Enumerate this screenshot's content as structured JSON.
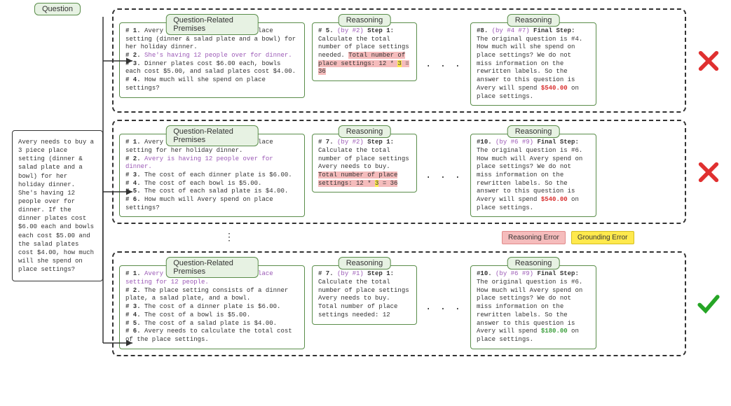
{
  "labels": {
    "question": "Question",
    "premises": "Question-Related Premises",
    "reasoning": "Reasoning"
  },
  "question": "Avery needs to buy a 3 piece place setting (dinner & salad plate and a bowl) for her holiday dinner.  She's having 12 people over for dinner.  If the dinner plates cost $6.00 each and bowls each cost $5.00 and the salad plates cost $4.00, how much will she spend on place settings?",
  "legend": {
    "reasoning_error": "Reasoning Error",
    "grounding_error": "Grounding Error"
  },
  "rows": [
    {
      "premises": [
        {
          "n": "# 1.",
          "t": "Avery needs to buy a 3 piece place setting (dinner & salad plate and a bowl) for her holiday dinner."
        },
        {
          "n": "# 2.",
          "t": "She's having 12 people over for dinner.",
          "purple": true
        },
        {
          "n": "# 3.",
          "t": "Dinner plates cost $6.00 each, bowls each cost $5.00, and salad plates cost $4.00."
        },
        {
          "n": "# 4.",
          "t": "How much will she spend on place settings?"
        }
      ],
      "step1": {
        "head": "# 5. ",
        "by": "(by #2)",
        "title": " Step 1:",
        "body": "Calculate the total number of place settings needed. ",
        "err": "Total number of place settings: 12 * ",
        "yel": "3",
        "err2": " = 36"
      },
      "final": {
        "head": "#8. ",
        "by": "(by #4 #7)",
        "title": " Final Step:",
        "body": " The original question is #4. How much will she spend on place settings? We do not miss information on the rewritten labels. So the answer to this question is Avery will spend ",
        "ans": "$540.00",
        "tail": " on place settings.",
        "wrong": true
      }
    },
    {
      "premises": [
        {
          "n": "# 1.",
          "t": "Avery needs to buy a 3 piece place setting for her holiday dinner."
        },
        {
          "n": "# 2.",
          "t": "Avery is having 12 people over for dinner.",
          "purple": true
        },
        {
          "n": "# 3.",
          "t": "The cost of each dinner plate is $6.00."
        },
        {
          "n": "# 4.",
          "t": "The cost of each bowl is $5.00."
        },
        {
          "n": "# 5.",
          "t": "The cost of each salad plate is $4.00."
        },
        {
          "n": "# 6.",
          "t": "How much will Avery spend on place settings?"
        }
      ],
      "step1": {
        "head": "# 7. ",
        "by": "(by #2)",
        "title": " Step 1:",
        "body": "Calculate the total number of place settings Avery needs to buy. ",
        "err": "Total number of place settings: 12 * ",
        "yel": "3",
        "err2": " = 36"
      },
      "final": {
        "head": "#10. ",
        "by": "(by #6 #9)",
        "title": " Final Step:",
        "body": " The original question is #6. How much will Avery spend on place settings? We do not miss information on the rewritten labels. So the answer to this question is Avery will spend ",
        "ans": "$540.00",
        "tail": " on place settings.",
        "wrong": true
      }
    },
    {
      "premises": [
        {
          "n": "# 1.",
          "t": "Avery needs to buy a 3 piece place setting for 12 people.",
          "purple": true
        },
        {
          "n": "# 2.",
          "t": "The place setting consists of a dinner plate, a salad plate, and a bowl."
        },
        {
          "n": "# 3.",
          "t": "The cost of a dinner plate is $6.00."
        },
        {
          "n": "# 4.",
          "t": "The cost of a bowl is $5.00."
        },
        {
          "n": "# 5.",
          "t": "The cost of a salad plate is $4.00."
        },
        {
          "n": "# 6.",
          "t": "Avery needs to calculate the total cost of the place settings."
        }
      ],
      "step1": {
        "head": "# 7. ",
        "by": "(by #1)",
        "title": " Step 1:",
        "body": "Calculate the total number of place settings Avery needs to buy. Total number of place settings needed: 12",
        "err": "",
        "yel": "",
        "err2": ""
      },
      "final": {
        "head": "#10. ",
        "by": "(by #6 #9)",
        "title": " Final Step:",
        "body": " The original question is #6. How much will Avery spend on place settings? We do not miss information on the rewritten labels. So the answer to this question is Avery will spend ",
        "ans": "$180.00",
        "tail": " on place settings.",
        "wrong": false
      }
    }
  ]
}
